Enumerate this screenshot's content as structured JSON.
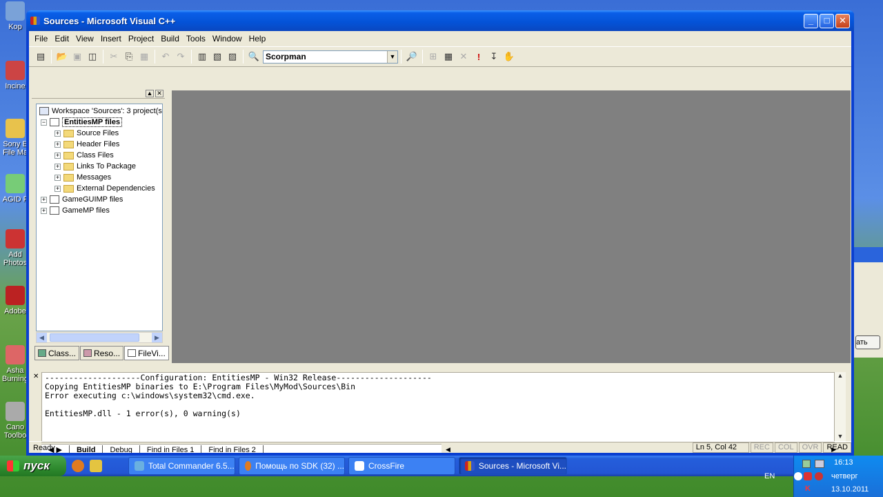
{
  "desktop": {
    "icons": [
      {
        "label": "Kop",
        "color": "#7aa2d8"
      },
      {
        "label": "Incine",
        "color": "#c44"
      },
      {
        "label": "Sony E File Ma",
        "color": "#e8c24c"
      },
      {
        "label": "AGID F",
        "color": "#7c7"
      },
      {
        "label": "Add Photos",
        "color": "#c33"
      },
      {
        "label": "Adobe",
        "color": "#b22"
      },
      {
        "label": "Asha Burning",
        "color": "#d66"
      },
      {
        "label": "Cano Toolbo",
        "color": "#aaa"
      }
    ]
  },
  "window": {
    "title": "Sources - Microsoft Visual C++",
    "menu": [
      "File",
      "Edit",
      "View",
      "Insert",
      "Project",
      "Build",
      "Tools",
      "Window",
      "Help"
    ],
    "combo_value": "Scorpman"
  },
  "workspace": {
    "root": "Workspace 'Sources': 3 project(s",
    "project_selected": "EntitiesMP files",
    "folders": [
      "Source Files",
      "Header Files",
      "Class Files",
      "Links To Package",
      "Messages",
      "External Dependencies"
    ],
    "projects": [
      "GameGUIMP files",
      "GameMP files"
    ],
    "tabs": [
      "Class...",
      "Reso...",
      "FileVi..."
    ]
  },
  "output": {
    "lines": [
      "--------------------Configuration: EntitiesMP - Win32 Release--------------------",
      "Copying EntitiesMP binaries to E:\\Program Files\\MyMod\\Sources\\Bin",
      "Error executing c:\\windows\\system32\\cmd.exe.",
      "",
      "EntitiesMP.dll - 1 error(s), 0 warning(s)"
    ],
    "tabs": [
      "Build",
      "Debug",
      "Find in Files 1",
      "Find in Files 2"
    ]
  },
  "status": {
    "text": "Ready",
    "position": "Ln 5, Col 42",
    "rec": "REC",
    "col": "COL",
    "ovr": "OVR",
    "read": "READ"
  },
  "taskbar": {
    "start": "пуск",
    "tasks": [
      "Total Commander 6.5...",
      "Помощь по SDK (32) ...",
      "CrossFire",
      "Sources - Microsoft Vi..."
    ],
    "lang": "EN",
    "time": "16:13",
    "day": "четверг",
    "date": "13.10.2011"
  },
  "background_fragment": "ать"
}
